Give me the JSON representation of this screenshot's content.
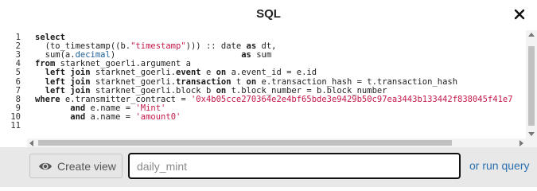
{
  "dialog": {
    "title": "SQL"
  },
  "editor": {
    "line_numbers": [
      "1",
      "2",
      "3",
      "4",
      "5",
      "6",
      "7",
      "8",
      "9",
      "10",
      "11"
    ],
    "lines": [
      [
        {
          "t": "select",
          "c": "kw"
        }
      ],
      [
        {
          "t": "  (to_timestamp((b.",
          "c": ""
        },
        {
          "t": "\"timestamp\"",
          "c": "str"
        },
        {
          "t": "))) :: date ",
          "c": ""
        },
        {
          "t": "as",
          "c": "kw"
        },
        {
          "t": " dt,",
          "c": ""
        }
      ],
      [
        {
          "t": "  sum(a.",
          "c": ""
        },
        {
          "t": "decimal",
          "c": "fn"
        },
        {
          "t": ")                         ",
          "c": ""
        },
        {
          "t": "as",
          "c": "kw"
        },
        {
          "t": " sum",
          "c": ""
        }
      ],
      [
        {
          "t": "from",
          "c": "kw"
        },
        {
          "t": " starknet_goerli.argument a",
          "c": ""
        }
      ],
      [
        {
          "t": "  left join",
          "c": "kw"
        },
        {
          "t": " starknet_goerli.",
          "c": ""
        },
        {
          "t": "event",
          "c": "kw"
        },
        {
          "t": " e ",
          "c": ""
        },
        {
          "t": "on",
          "c": "kw"
        },
        {
          "t": " a.event_id = e.id",
          "c": ""
        }
      ],
      [
        {
          "t": "  left join",
          "c": "kw"
        },
        {
          "t": " starknet_goerli.",
          "c": ""
        },
        {
          "t": "transaction",
          "c": "kw"
        },
        {
          "t": " t ",
          "c": ""
        },
        {
          "t": "on",
          "c": "kw"
        },
        {
          "t": " e.transaction_hash = t.transaction_hash",
          "c": ""
        }
      ],
      [
        {
          "t": "  left join",
          "c": "kw"
        },
        {
          "t": " starknet_goerli.block b ",
          "c": ""
        },
        {
          "t": "on",
          "c": "kw"
        },
        {
          "t": " t.block_number = b.block_number",
          "c": ""
        }
      ],
      [
        {
          "t": "where",
          "c": "kw"
        },
        {
          "t": " e.transmitter_contract = ",
          "c": ""
        },
        {
          "t": "'0x4b05cce270364e2e4bf65bde3e9429b50c97ea3443b133442f838045f41e7",
          "c": "str"
        }
      ],
      [
        {
          "t": "       ",
          "c": ""
        },
        {
          "t": "and",
          "c": "kw"
        },
        {
          "t": " e.name = ",
          "c": ""
        },
        {
          "t": "'Mint'",
          "c": "str"
        }
      ],
      [
        {
          "t": "       ",
          "c": ""
        },
        {
          "t": "and",
          "c": "kw"
        },
        {
          "t": " a.name = ",
          "c": ""
        },
        {
          "t": "'amount0'",
          "c": "str"
        }
      ],
      [
        {
          "t": "",
          "c": ""
        }
      ]
    ]
  },
  "footer": {
    "create_view_label": "Create view",
    "view_name_placeholder": "daily_mint",
    "run_query_label": "or run query"
  },
  "colors": {
    "keyword": "#1a1a1a",
    "string": "#c41a4a",
    "column": "#1d5f9a",
    "link": "#2a6fb0",
    "footer_bg": "#e8e8e8"
  },
  "icons": {
    "close": "close-icon",
    "create_view": "eye-icon"
  }
}
